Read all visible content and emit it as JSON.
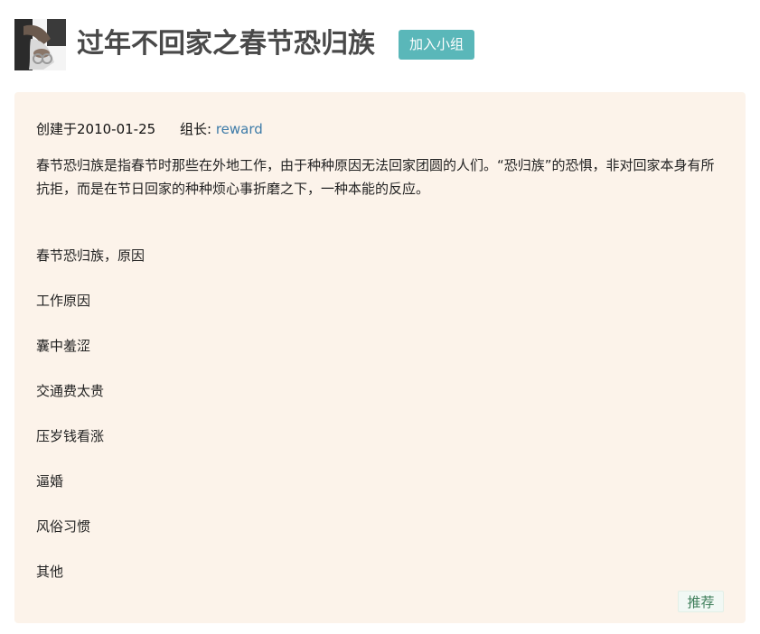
{
  "group": {
    "avatar_icon": "group-avatar-photo",
    "title": "过年不回家之春节恐归族",
    "join_label": "加入小组",
    "accent_color": "#5ab7b9"
  },
  "info": {
    "created_text": "创建于2010-01-25",
    "owner_label": "组长:",
    "owner_name": "reward",
    "description": "春节恐归族是指春节时那些在外地工作，由于种种原因无法回家团圆的人们。“恐归族”的恐惧，非对回家本身有所抗拒，而是在节日回家的种种烦心事折磨之下，一种本能的反应。",
    "items": [
      "春节恐归族，原因",
      "工作原因",
      "囊中羞涩",
      "交通费太贵",
      "压岁钱看涨",
      "逼婚",
      "风俗习惯",
      "其他"
    ],
    "recommend_label": "推荐",
    "card_bg": "#fcf3ea"
  }
}
